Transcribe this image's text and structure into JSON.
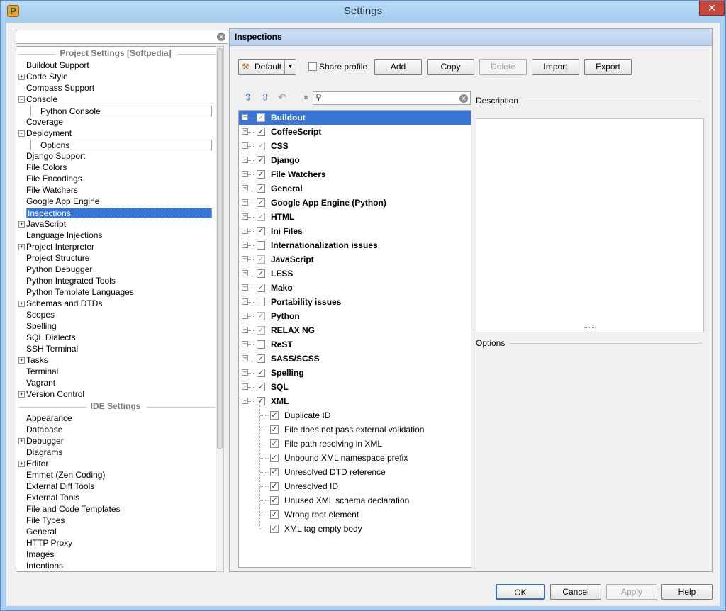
{
  "window": {
    "title": "Settings",
    "close_label": "✕"
  },
  "left": {
    "search_value": "",
    "project_header": "Project Settings [Softpedia]",
    "ide_header": "IDE Settings",
    "project_items": [
      {
        "label": "Buildout Support",
        "expander": ""
      },
      {
        "label": "Code Style",
        "expander": "+"
      },
      {
        "label": "Compass Support",
        "expander": ""
      },
      {
        "label": "Console",
        "expander": "−"
      },
      {
        "label": "Python Console",
        "expander": "",
        "child": true
      },
      {
        "label": "Coverage",
        "expander": ""
      },
      {
        "label": "Deployment",
        "expander": "−"
      },
      {
        "label": "Options",
        "expander": "",
        "child": true
      },
      {
        "label": "Django Support",
        "expander": ""
      },
      {
        "label": "File Colors",
        "expander": ""
      },
      {
        "label": "File Encodings",
        "expander": ""
      },
      {
        "label": "File Watchers",
        "expander": ""
      },
      {
        "label": "Google App Engine",
        "expander": ""
      },
      {
        "label": "Inspections",
        "expander": "",
        "selected": true
      },
      {
        "label": "JavaScript",
        "expander": "+"
      },
      {
        "label": "Language Injections",
        "expander": ""
      },
      {
        "label": "Project Interpreter",
        "expander": "+"
      },
      {
        "label": "Project Structure",
        "expander": ""
      },
      {
        "label": "Python Debugger",
        "expander": ""
      },
      {
        "label": "Python Integrated Tools",
        "expander": ""
      },
      {
        "label": "Python Template Languages",
        "expander": ""
      },
      {
        "label": "Schemas and DTDs",
        "expander": "+"
      },
      {
        "label": "Scopes",
        "expander": ""
      },
      {
        "label": "Spelling",
        "expander": ""
      },
      {
        "label": "SQL Dialects",
        "expander": ""
      },
      {
        "label": "SSH Terminal",
        "expander": ""
      },
      {
        "label": "Tasks",
        "expander": "+"
      },
      {
        "label": "Terminal",
        "expander": ""
      },
      {
        "label": "Vagrant",
        "expander": ""
      },
      {
        "label": "Version Control",
        "expander": "+"
      }
    ],
    "ide_items": [
      {
        "label": "Appearance",
        "expander": ""
      },
      {
        "label": "Database",
        "expander": ""
      },
      {
        "label": "Debugger",
        "expander": "+"
      },
      {
        "label": "Diagrams",
        "expander": ""
      },
      {
        "label": "Editor",
        "expander": "+"
      },
      {
        "label": "Emmet (Zen Coding)",
        "expander": ""
      },
      {
        "label": "External Diff Tools",
        "expander": ""
      },
      {
        "label": "External Tools",
        "expander": ""
      },
      {
        "label": "File and Code Templates",
        "expander": ""
      },
      {
        "label": "File Types",
        "expander": ""
      },
      {
        "label": "General",
        "expander": ""
      },
      {
        "label": "HTTP Proxy",
        "expander": ""
      },
      {
        "label": "Images",
        "expander": ""
      },
      {
        "label": "Intentions",
        "expander": ""
      }
    ]
  },
  "right": {
    "header": "Inspections",
    "profile_value": "Default",
    "share_profile_label": "Share profile",
    "buttons": {
      "add": "Add",
      "copy": "Copy",
      "delete": "Delete",
      "import": "Import",
      "export": "Export"
    },
    "filter_prompt": "»",
    "search_value": "",
    "description_label": "Description",
    "options_label": "Options",
    "inspections": [
      {
        "label": "Buildout",
        "check": "dim",
        "expander": "+",
        "selected": true
      },
      {
        "label": "CoffeeScript",
        "check": "on",
        "expander": "+"
      },
      {
        "label": "CSS",
        "check": "dim",
        "expander": "+"
      },
      {
        "label": "Django",
        "check": "on",
        "expander": "+"
      },
      {
        "label": "File Watchers",
        "check": "on",
        "expander": "+"
      },
      {
        "label": "General",
        "check": "on",
        "expander": "+"
      },
      {
        "label": "Google App Engine (Python)",
        "check": "on",
        "expander": "+"
      },
      {
        "label": "HTML",
        "check": "dim",
        "expander": "+"
      },
      {
        "label": "Ini Files",
        "check": "on",
        "expander": "+"
      },
      {
        "label": "Internationalization issues",
        "check": "off",
        "expander": "+"
      },
      {
        "label": "JavaScript",
        "check": "dim",
        "expander": "+"
      },
      {
        "label": "LESS",
        "check": "on",
        "expander": "+"
      },
      {
        "label": "Mako",
        "check": "on",
        "expander": "+"
      },
      {
        "label": "Portability issues",
        "check": "off",
        "expander": "+"
      },
      {
        "label": "Python",
        "check": "dim",
        "expander": "+"
      },
      {
        "label": "RELAX NG",
        "check": "dim",
        "expander": "+"
      },
      {
        "label": "ReST",
        "check": "off",
        "expander": "+"
      },
      {
        "label": "SASS/SCSS",
        "check": "on",
        "expander": "+"
      },
      {
        "label": "Spelling",
        "check": "on",
        "expander": "+"
      },
      {
        "label": "SQL",
        "check": "on",
        "expander": "+"
      },
      {
        "label": "XML",
        "check": "on",
        "expander": "−"
      }
    ],
    "xml_children": [
      {
        "label": "Duplicate ID",
        "check": "on"
      },
      {
        "label": "File does not pass external validation",
        "check": "on"
      },
      {
        "label": "File path resolving in XML",
        "check": "on"
      },
      {
        "label": "Unbound XML namespace prefix",
        "check": "on"
      },
      {
        "label": "Unresolved DTD reference",
        "check": "on"
      },
      {
        "label": "Unresolved ID",
        "check": "on"
      },
      {
        "label": "Unused XML schema declaration",
        "check": "on"
      },
      {
        "label": "Wrong root element",
        "check": "on"
      },
      {
        "label": "XML tag empty body",
        "check": "on"
      }
    ]
  },
  "footer": {
    "ok": "OK",
    "cancel": "Cancel",
    "apply": "Apply",
    "help": "Help"
  }
}
